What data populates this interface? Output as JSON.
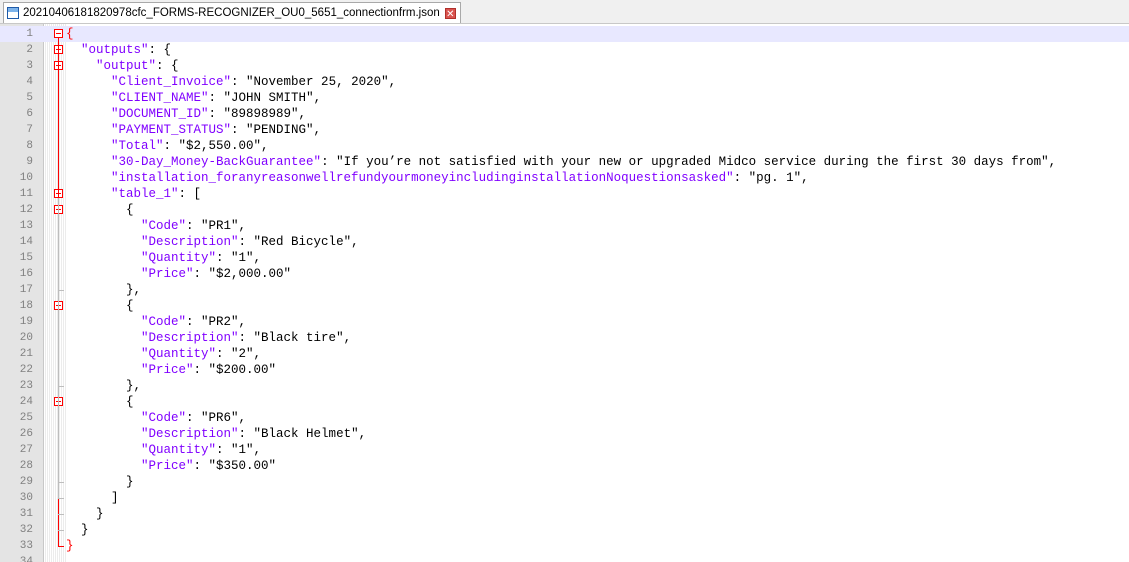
{
  "tab": {
    "title": "20210406181820978cfc_FORMS-RECOGNIZER_OU0_5651_connectionfrm.json"
  },
  "lines": [
    {
      "n": "1",
      "indent": "",
      "parts": [
        {
          "t": "{",
          "c": "brace-red"
        }
      ]
    },
    {
      "n": "2",
      "indent": "  ",
      "parts": [
        {
          "t": "\"outputs\"",
          "c": "k"
        },
        {
          "t": ": {",
          "c": "s"
        }
      ]
    },
    {
      "n": "3",
      "indent": "    ",
      "parts": [
        {
          "t": "\"output\"",
          "c": "k"
        },
        {
          "t": ": {",
          "c": "s"
        }
      ]
    },
    {
      "n": "4",
      "indent": "      ",
      "parts": [
        {
          "t": "\"Client_Invoice\"",
          "c": "k"
        },
        {
          "t": ": \"November 25, 2020\",",
          "c": "s"
        }
      ]
    },
    {
      "n": "5",
      "indent": "      ",
      "parts": [
        {
          "t": "\"CLIENT_NAME\"",
          "c": "k"
        },
        {
          "t": ": \"JOHN SMITH\",",
          "c": "s"
        }
      ]
    },
    {
      "n": "6",
      "indent": "      ",
      "parts": [
        {
          "t": "\"DOCUMENT_ID\"",
          "c": "k"
        },
        {
          "t": ": \"89898989\",",
          "c": "s"
        }
      ]
    },
    {
      "n": "7",
      "indent": "      ",
      "parts": [
        {
          "t": "\"PAYMENT_STATUS\"",
          "c": "k"
        },
        {
          "t": ": \"PENDING\",",
          "c": "s"
        }
      ]
    },
    {
      "n": "8",
      "indent": "      ",
      "parts": [
        {
          "t": "\"Total\"",
          "c": "k"
        },
        {
          "t": ": \"$2,550.00\",",
          "c": "s"
        }
      ]
    },
    {
      "n": "9",
      "indent": "      ",
      "parts": [
        {
          "t": "\"30-Day_Money-BackGuarantee\"",
          "c": "k"
        },
        {
          "t": ": \"If you’re not satisfied with your new or upgraded Midco service during the first 30 days from\",",
          "c": "s"
        }
      ]
    },
    {
      "n": "10",
      "indent": "      ",
      "parts": [
        {
          "t": "\"installation_foranyreasonwellrefundyourmoneyincludinginstallationNoquestionsasked\"",
          "c": "k"
        },
        {
          "t": ": \"pg. 1\",",
          "c": "s"
        }
      ]
    },
    {
      "n": "11",
      "indent": "      ",
      "parts": [
        {
          "t": "\"table_1\"",
          "c": "k"
        },
        {
          "t": ": [",
          "c": "s"
        }
      ]
    },
    {
      "n": "12",
      "indent": "        ",
      "parts": [
        {
          "t": "{",
          "c": "s"
        }
      ]
    },
    {
      "n": "13",
      "indent": "          ",
      "parts": [
        {
          "t": "\"Code\"",
          "c": "k"
        },
        {
          "t": ": \"PR1\",",
          "c": "s"
        }
      ]
    },
    {
      "n": "14",
      "indent": "          ",
      "parts": [
        {
          "t": "\"Description\"",
          "c": "k"
        },
        {
          "t": ": \"Red Bicycle\",",
          "c": "s"
        }
      ]
    },
    {
      "n": "15",
      "indent": "          ",
      "parts": [
        {
          "t": "\"Quantity\"",
          "c": "k"
        },
        {
          "t": ": \"1\",",
          "c": "s"
        }
      ]
    },
    {
      "n": "16",
      "indent": "          ",
      "parts": [
        {
          "t": "\"Price\"",
          "c": "k"
        },
        {
          "t": ": \"$2,000.00\"",
          "c": "s"
        }
      ]
    },
    {
      "n": "17",
      "indent": "        ",
      "parts": [
        {
          "t": "},",
          "c": "s"
        }
      ]
    },
    {
      "n": "18",
      "indent": "        ",
      "parts": [
        {
          "t": "{",
          "c": "s"
        }
      ]
    },
    {
      "n": "19",
      "indent": "          ",
      "parts": [
        {
          "t": "\"Code\"",
          "c": "k"
        },
        {
          "t": ": \"PR2\",",
          "c": "s"
        }
      ]
    },
    {
      "n": "20",
      "indent": "          ",
      "parts": [
        {
          "t": "\"Description\"",
          "c": "k"
        },
        {
          "t": ": \"Black tire\",",
          "c": "s"
        }
      ]
    },
    {
      "n": "21",
      "indent": "          ",
      "parts": [
        {
          "t": "\"Quantity\"",
          "c": "k"
        },
        {
          "t": ": \"2\",",
          "c": "s"
        }
      ]
    },
    {
      "n": "22",
      "indent": "          ",
      "parts": [
        {
          "t": "\"Price\"",
          "c": "k"
        },
        {
          "t": ": \"$200.00\"",
          "c": "s"
        }
      ]
    },
    {
      "n": "23",
      "indent": "        ",
      "parts": [
        {
          "t": "},",
          "c": "s"
        }
      ]
    },
    {
      "n": "24",
      "indent": "        ",
      "parts": [
        {
          "t": "{",
          "c": "s"
        }
      ]
    },
    {
      "n": "25",
      "indent": "          ",
      "parts": [
        {
          "t": "\"Code\"",
          "c": "k"
        },
        {
          "t": ": \"PR6\",",
          "c": "s"
        }
      ]
    },
    {
      "n": "26",
      "indent": "          ",
      "parts": [
        {
          "t": "\"Description\"",
          "c": "k"
        },
        {
          "t": ": \"Black Helmet\",",
          "c": "s"
        }
      ]
    },
    {
      "n": "27",
      "indent": "          ",
      "parts": [
        {
          "t": "\"Quantity\"",
          "c": "k"
        },
        {
          "t": ": \"1\",",
          "c": "s"
        }
      ]
    },
    {
      "n": "28",
      "indent": "          ",
      "parts": [
        {
          "t": "\"Price\"",
          "c": "k"
        },
        {
          "t": ": \"$350.00\"",
          "c": "s"
        }
      ]
    },
    {
      "n": "29",
      "indent": "        ",
      "parts": [
        {
          "t": "}",
          "c": "s"
        }
      ]
    },
    {
      "n": "30",
      "indent": "      ",
      "parts": [
        {
          "t": "]",
          "c": "s"
        }
      ]
    },
    {
      "n": "31",
      "indent": "    ",
      "parts": [
        {
          "t": "}",
          "c": "s"
        }
      ]
    },
    {
      "n": "32",
      "indent": "  ",
      "parts": [
        {
          "t": "}",
          "c": "s"
        }
      ]
    },
    {
      "n": "33",
      "indent": "",
      "parts": [
        {
          "t": "}",
          "c": "brace-red"
        }
      ]
    },
    {
      "n": "34",
      "indent": "",
      "parts": []
    }
  ],
  "folds": [
    "1",
    "2",
    "3",
    "11",
    "12",
    "18",
    "24"
  ],
  "colors": {
    "key": "#8000ff",
    "string": "#000000",
    "brace_highlight": "#ff0000",
    "current_line": "#e8e8ff"
  }
}
